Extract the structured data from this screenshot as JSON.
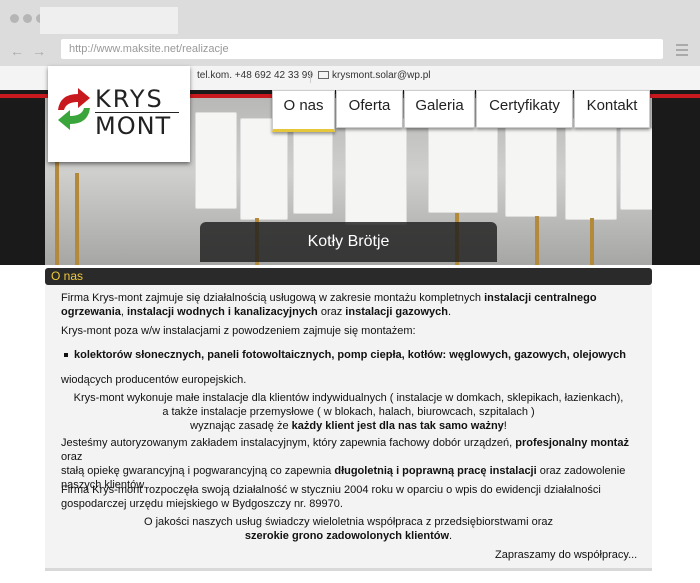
{
  "browser": {
    "url": "http://www.maksite.net/realizacje",
    "back": "←",
    "forward": "→"
  },
  "contact": {
    "phone": "tel.kom. +48 692 42 33 99",
    "email": "krysmont.solar@wp.pl"
  },
  "logo": {
    "line1": "KRYS",
    "line2": "MONT"
  },
  "menu": [
    "O nas",
    "Oferta",
    "Galeria",
    "Certyfikaty",
    "Kontakt"
  ],
  "hero": {
    "caption": "Kotły Brötje"
  },
  "section": {
    "title": "O nas"
  },
  "content": {
    "p1a": "Firma Krys-mont zajmuje się działalnością usługową w zakresie montażu kompletnych ",
    "p1b": "instalacji centralnego",
    "p1c": "ogrzewania",
    "p1d": ", ",
    "p1e": "instalacji wodnych i kanalizacyjnych",
    "p1f": " oraz ",
    "p1g": "instalacji gazowych",
    "p1h": ".",
    "p2": "Krys-mont poza w/w instalacjami z powodzeniem zajmuje się montażem:",
    "bullet": "kolektorów słonecznych, paneli fotowoltaicznych, pomp ciepła, kotłów: węglowych, gazowych, olejowych",
    "p3": "wiodących producentów europejskich.",
    "c1": "Krys-mont wykonuje małe instalacje dla klientów indywidualnych ( instalacje w domkach, sklepikach, łazienkach),",
    "c2": "a także instalacje przemysłowe ( w blokach, halach, biurowcach, szpitalach )",
    "c3a": "wyznając zasadę że ",
    "c3b": "każdy klient jest dla nas tak samo ważny",
    "c3c": "!",
    "p4a": "Jesteśmy autoryzowanym zakładem instalacyjnym, który zapewnia fachowy dobór urządzeń, ",
    "p4b": "profesjonalny montaż",
    "p4c": " oraz",
    "p4d": "stałą opiekę gwarancyjną i pogwarancyjną co zapewnia ",
    "p4e": "długoletnią i poprawną pracę instalacji",
    "p4f": " oraz zadowolenie",
    "p4g": "naszych klientów.",
    "p5a": "Firma Krys-mont rozpoczęła swoją działalność w styczniu 2004 roku w oparciu o wpis do ewidencji działalności",
    "p5b": "gospodarczej urzędu miejskiego w Bydgoszczy nr. 89970.",
    "c4": "O jakości naszych usług świadczy wieloletnia współpraca z przedsiębiorstwami oraz",
    "c5": "szerokie grono zadowolonych klientów",
    "c5b": ".",
    "closing": "Zapraszamy do współpracy..."
  }
}
